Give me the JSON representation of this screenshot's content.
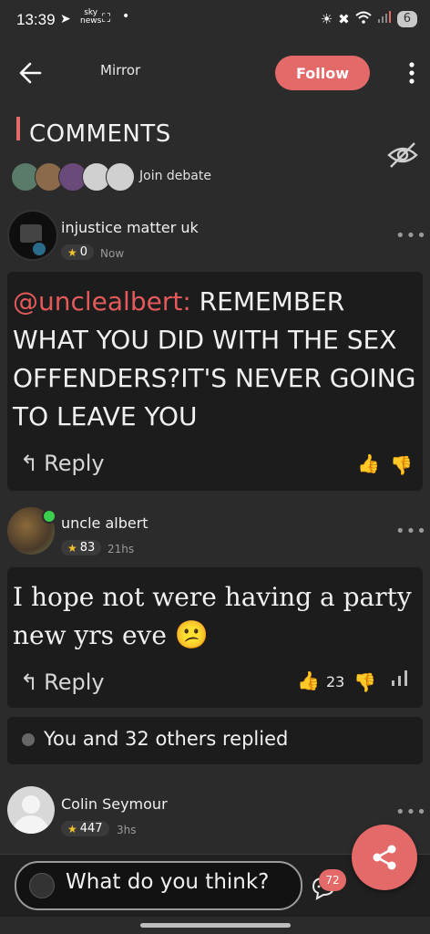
{
  "status": {
    "time": "13:39",
    "sky_label": "sky",
    "sky_sub": "news",
    "battery": "6"
  },
  "header": {
    "title": "Mirror",
    "follow_label": "Follow"
  },
  "comments": {
    "heading": "COMMENTS",
    "join_label": "Join debate"
  },
  "posts": [
    {
      "name": "injustice matter uk",
      "stars": "0",
      "time": "Now",
      "mention": "@unclealbert:",
      "text": " REMEMBER WHAT YOU DID WITH THE SEX OFFENDERS?IT'S NEVER GOING TO LEAVE YOU",
      "reply_label": "Reply"
    },
    {
      "name": "uncle albert",
      "stars": "83",
      "time": "21hs",
      "text": "I hope not were having a party new yrs eve",
      "emoji": "😕",
      "reply_label": "Reply",
      "likes": "23"
    },
    {
      "name": "Colin Seymour",
      "stars": "447",
      "time": "3hs"
    }
  ],
  "replied_summary": "You and 32 others replied",
  "composer": {
    "placeholder": "What do you think?",
    "comment_count": "72"
  },
  "colors": {
    "accent": "#e46a6a",
    "card": "#1c1c1c",
    "bg": "#2b2b2b",
    "star": "#f2c12e"
  }
}
